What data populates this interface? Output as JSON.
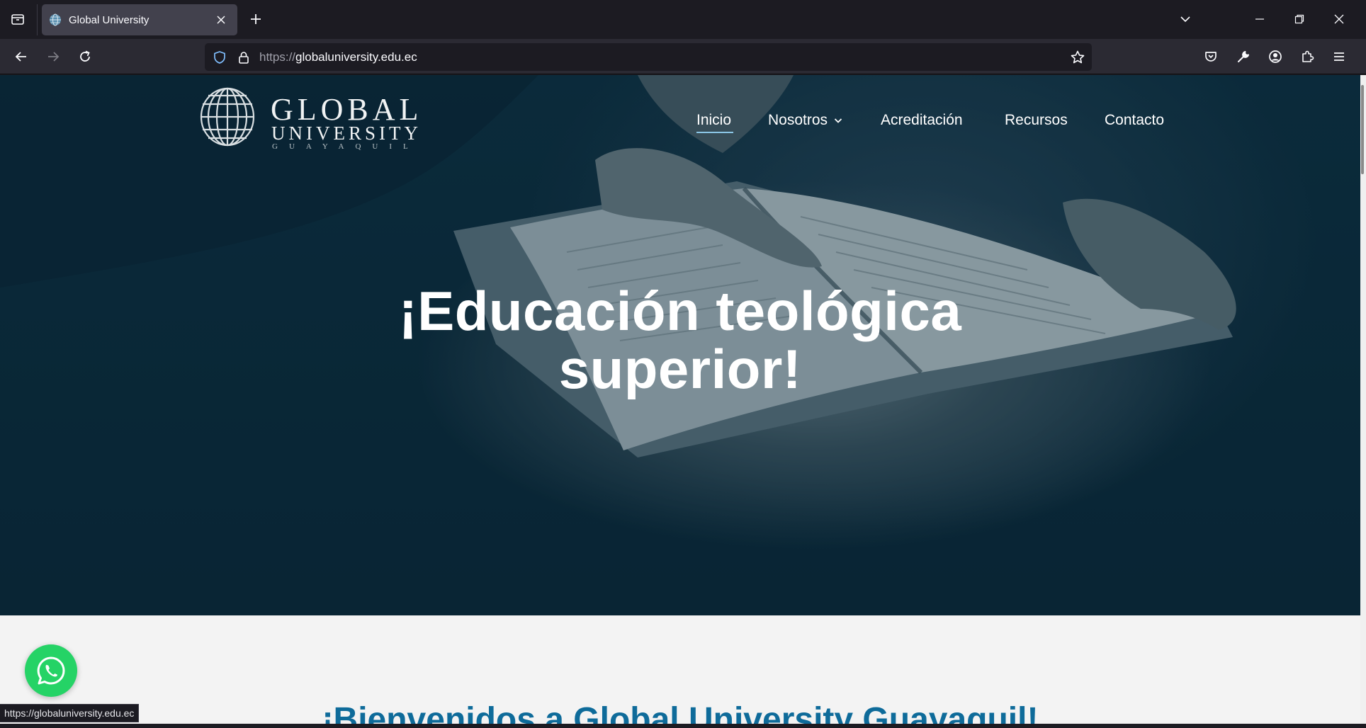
{
  "browser": {
    "tab": {
      "title": "Global University"
    },
    "url": {
      "protocol": "https://",
      "host": "globaluniversity.edu.ec"
    },
    "status_url": "https://globaluniversity.edu.ec"
  },
  "site": {
    "logo": {
      "line1": "GLOBAL",
      "line2": "UNIVERSITY",
      "line3": "GUAYAQUIL"
    },
    "nav": {
      "inicio": "Inicio",
      "nosotros": "Nosotros",
      "acreditacion": "Acreditación",
      "recursos": "Recursos",
      "contacto": "Contacto"
    },
    "hero": {
      "line1": "¡Educación teológica",
      "line2": "superior!"
    },
    "welcome": "¡Bienvenidos a Global University Guayaquil!"
  },
  "colors": {
    "accent": "#0e6b9a",
    "active_underline": "#8cc6e6",
    "whatsapp": "#25d366"
  }
}
